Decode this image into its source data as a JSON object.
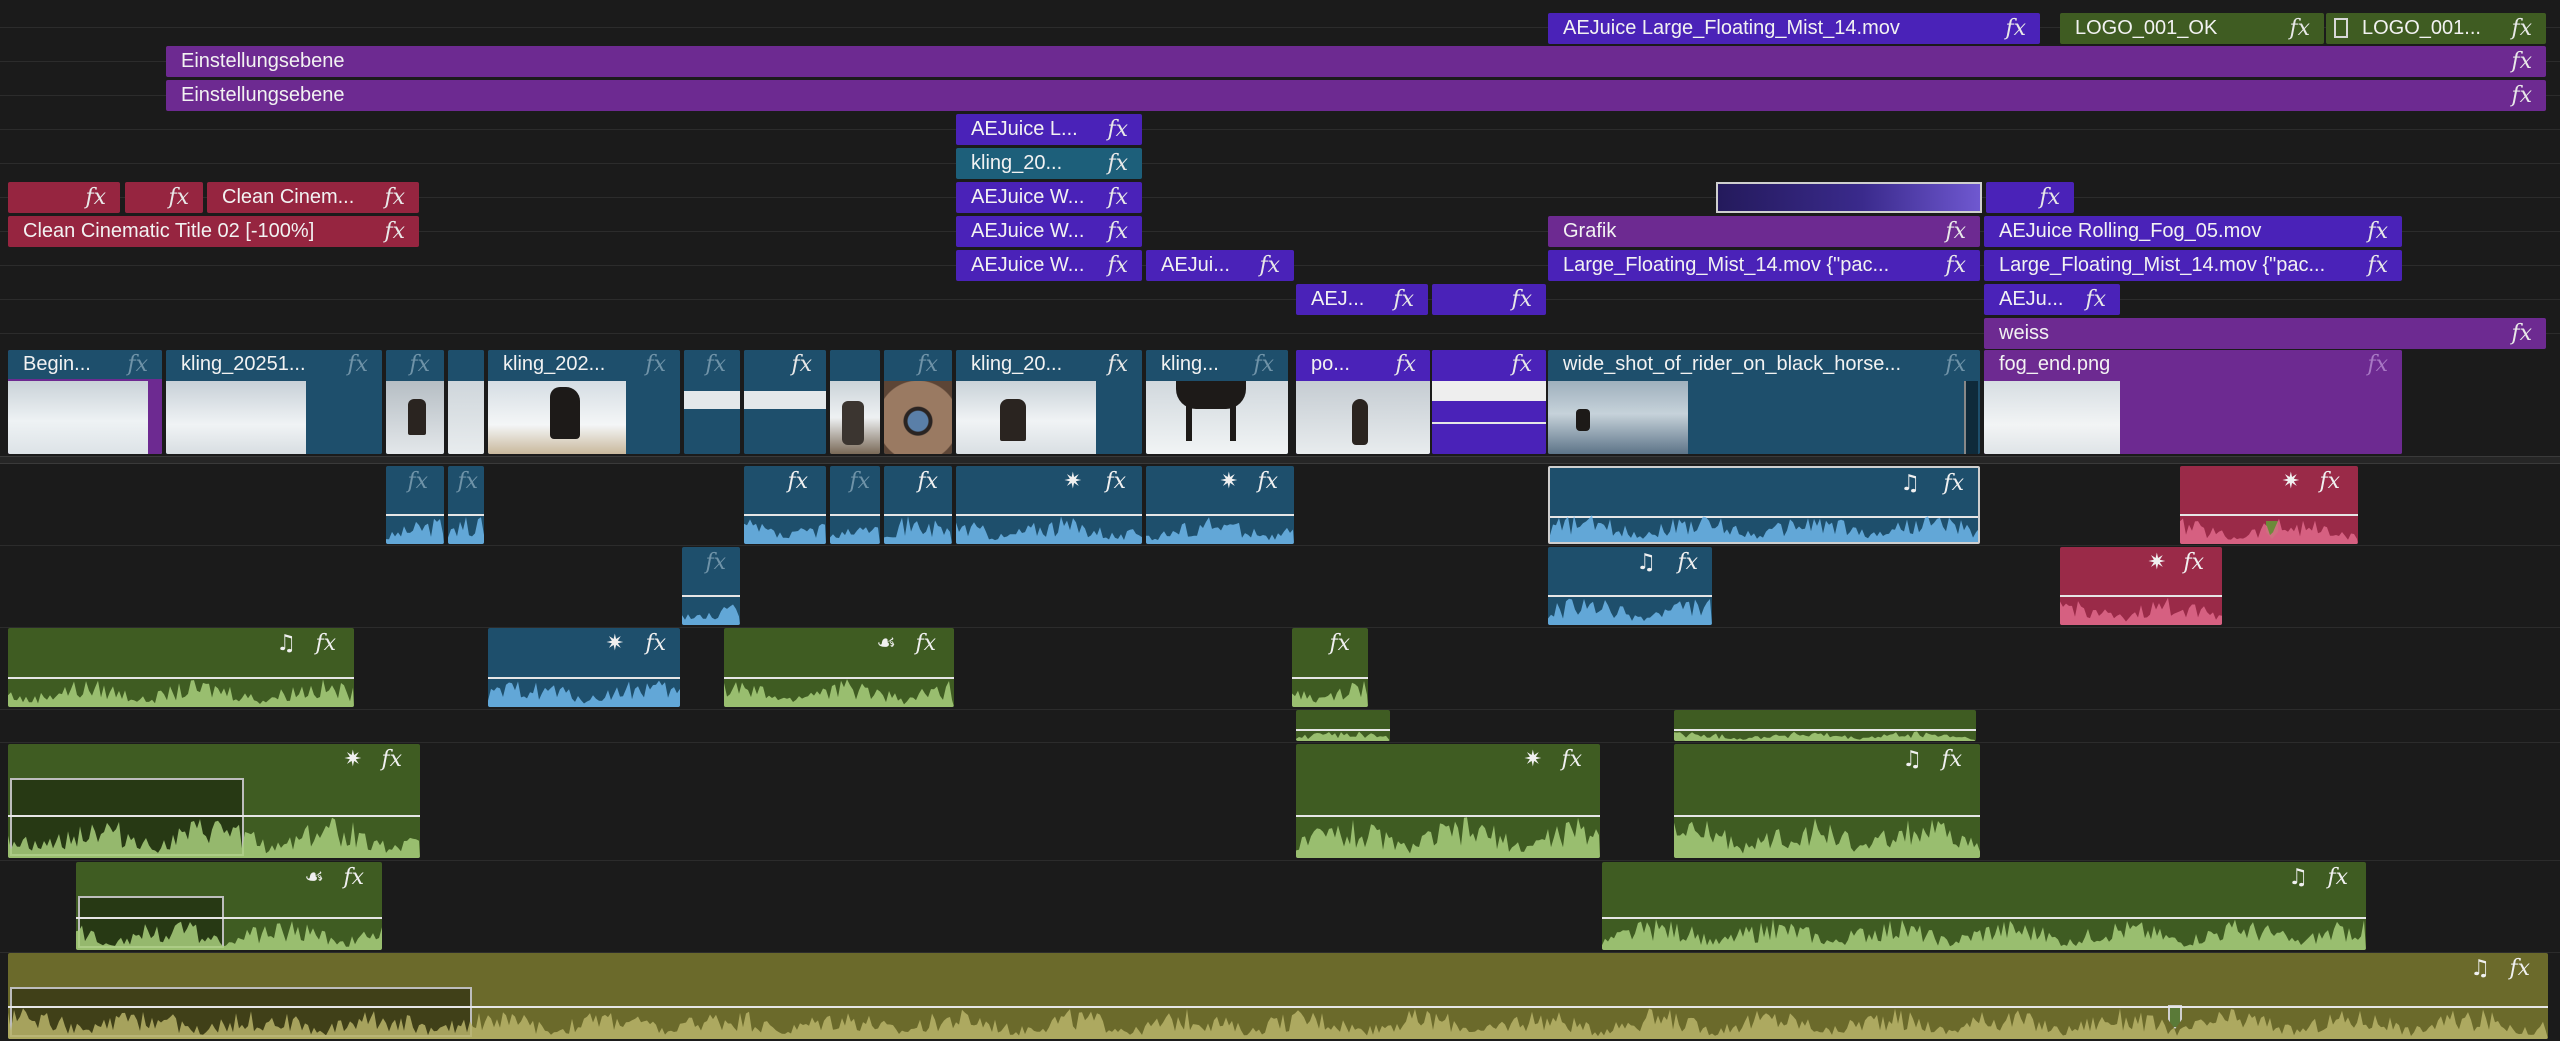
{
  "timeline": {
    "colors": {
      "background": "#1b1b1b",
      "purple": "#6d2a91",
      "violet": "#4a22b8",
      "red": "#962540",
      "teal": "#1d5f7a",
      "blue": "#1e4f6c",
      "green": "#3f5c22",
      "olive": "#6b6a2b",
      "pink": "#9a2a48"
    },
    "video_clips": [
      {
        "label": "AEJuice Large_Floating_Mist_14.mov",
        "color": "violet",
        "fx": "fx"
      },
      {
        "label": "LOGO_001_OK",
        "color": "green",
        "fx": "fx"
      },
      {
        "label": "LOGO_001...",
        "color": "green",
        "fx": "fx"
      },
      {
        "label": "Einstellungsebene",
        "color": "purple",
        "fx": "fx"
      },
      {
        "label": "Einstellungsebene",
        "color": "purple",
        "fx": "fx"
      },
      {
        "label": "AEJuice L...",
        "color": "violet",
        "fx": "fx"
      },
      {
        "label": "kling_20...",
        "color": "teal",
        "fx": "fx"
      },
      {
        "label": "",
        "color": "red",
        "fx": "fx"
      },
      {
        "label": "",
        "color": "red",
        "fx": "fx"
      },
      {
        "label": "Clean Cinem...",
        "color": "red",
        "fx": "fx"
      },
      {
        "label": "AEJuice W...",
        "color": "violet",
        "fx": "fx"
      },
      {
        "label": "",
        "color": "violet",
        "fx": "fx"
      },
      {
        "label": "Clean Cinematic Title 02 [-100%]",
        "color": "red",
        "fx": "fx"
      },
      {
        "label": "AEJuice W...",
        "color": "violet",
        "fx": "fx"
      },
      {
        "label": "Grafik",
        "color": "purple",
        "fx": "fx"
      },
      {
        "label": "AEJuice Rolling_Fog_05.mov",
        "color": "violet",
        "fx": "fx"
      },
      {
        "label": "AEJuice W...",
        "color": "violet",
        "fx": "fx"
      },
      {
        "label": "AEJui...",
        "color": "violet",
        "fx": "fx"
      },
      {
        "label": "Large_Floating_Mist_14.mov  {\"pac...",
        "color": "violet",
        "fx": "fx"
      },
      {
        "label": "Large_Floating_Mist_14.mov  {\"pac...",
        "color": "violet",
        "fx": "fx"
      },
      {
        "label": "AEJ...",
        "color": "violet",
        "fx": "fx"
      },
      {
        "label": "",
        "color": "violet",
        "fx": "fx"
      },
      {
        "label": "AEJu...",
        "color": "violet",
        "fx": "fx"
      },
      {
        "label": "weiss",
        "color": "purple",
        "fx": "fx"
      }
    ],
    "main_clips": [
      {
        "label": "Begin...",
        "fx": "fx",
        "color": "purple"
      },
      {
        "label": "kling_20251...",
        "fx": "fx",
        "color": "blue"
      },
      {
        "label": "",
        "fx": "fx",
        "color": "blue"
      },
      {
        "label": "",
        "fx": "",
        "color": "blue"
      },
      {
        "label": "kling_202...",
        "fx": "fx",
        "color": "blue"
      },
      {
        "label": "",
        "fx": "fx",
        "color": "blue"
      },
      {
        "label": "",
        "fx": "fx",
        "color": "blue"
      },
      {
        "label": "",
        "fx": "",
        "color": "blue"
      },
      {
        "label": "",
        "fx": "fx",
        "color": "blue"
      },
      {
        "label": "kling_20...",
        "fx": "fx",
        "color": "blue"
      },
      {
        "label": "kling...",
        "fx": "fx",
        "color": "blue"
      },
      {
        "label": "po...",
        "fx": "fx",
        "color": "violet"
      },
      {
        "label": "",
        "fx": "fx",
        "color": "violet"
      },
      {
        "label": "wide_shot_of_rider_on_black_horse...",
        "fx": "fx",
        "color": "blue"
      },
      {
        "label": "fog_end.png",
        "fx": "fx",
        "color": "purple"
      }
    ],
    "audio_clips": [
      {
        "fx": "fx",
        "icon": "",
        "color": "blue"
      },
      {
        "fx": "fx",
        "icon": "",
        "color": "blue"
      },
      {
        "fx": "fx",
        "icon": "",
        "color": "blue"
      },
      {
        "fx": "fx",
        "icon": "",
        "color": "blue"
      },
      {
        "fx": "fx",
        "icon": "",
        "color": "blue"
      },
      {
        "fx": "fx",
        "icon": "✷",
        "color": "blue"
      },
      {
        "fx": "fx",
        "icon": "✷",
        "color": "blue"
      },
      {
        "fx": "fx",
        "icon": "♫",
        "color": "blue"
      },
      {
        "fx": "fx",
        "icon": "✷",
        "color": "pink"
      },
      {
        "fx": "fx",
        "icon": "",
        "color": "blue"
      },
      {
        "fx": "fx",
        "icon": "♫",
        "color": "blue"
      },
      {
        "fx": "fx",
        "icon": "✷",
        "color": "pink"
      },
      {
        "fx": "fx",
        "icon": "♫",
        "color": "green"
      },
      {
        "fx": "fx",
        "icon": "✷",
        "color": "blue"
      },
      {
        "fx": "fx",
        "icon": "☙",
        "color": "green"
      },
      {
        "fx": "fx",
        "icon": "",
        "color": "green"
      },
      {
        "fx": "",
        "icon": "",
        "color": "green"
      },
      {
        "fx": "",
        "icon": "",
        "color": "green"
      },
      {
        "fx": "fx",
        "icon": "✷",
        "color": "green"
      },
      {
        "fx": "fx",
        "icon": "✷",
        "color": "green"
      },
      {
        "fx": "fx",
        "icon": "♫",
        "color": "green"
      },
      {
        "fx": "fx",
        "icon": "☙",
        "color": "green"
      },
      {
        "fx": "fx",
        "icon": "♫",
        "color": "green"
      },
      {
        "fx": "fx",
        "icon": "♫",
        "color": "olive"
      }
    ]
  }
}
